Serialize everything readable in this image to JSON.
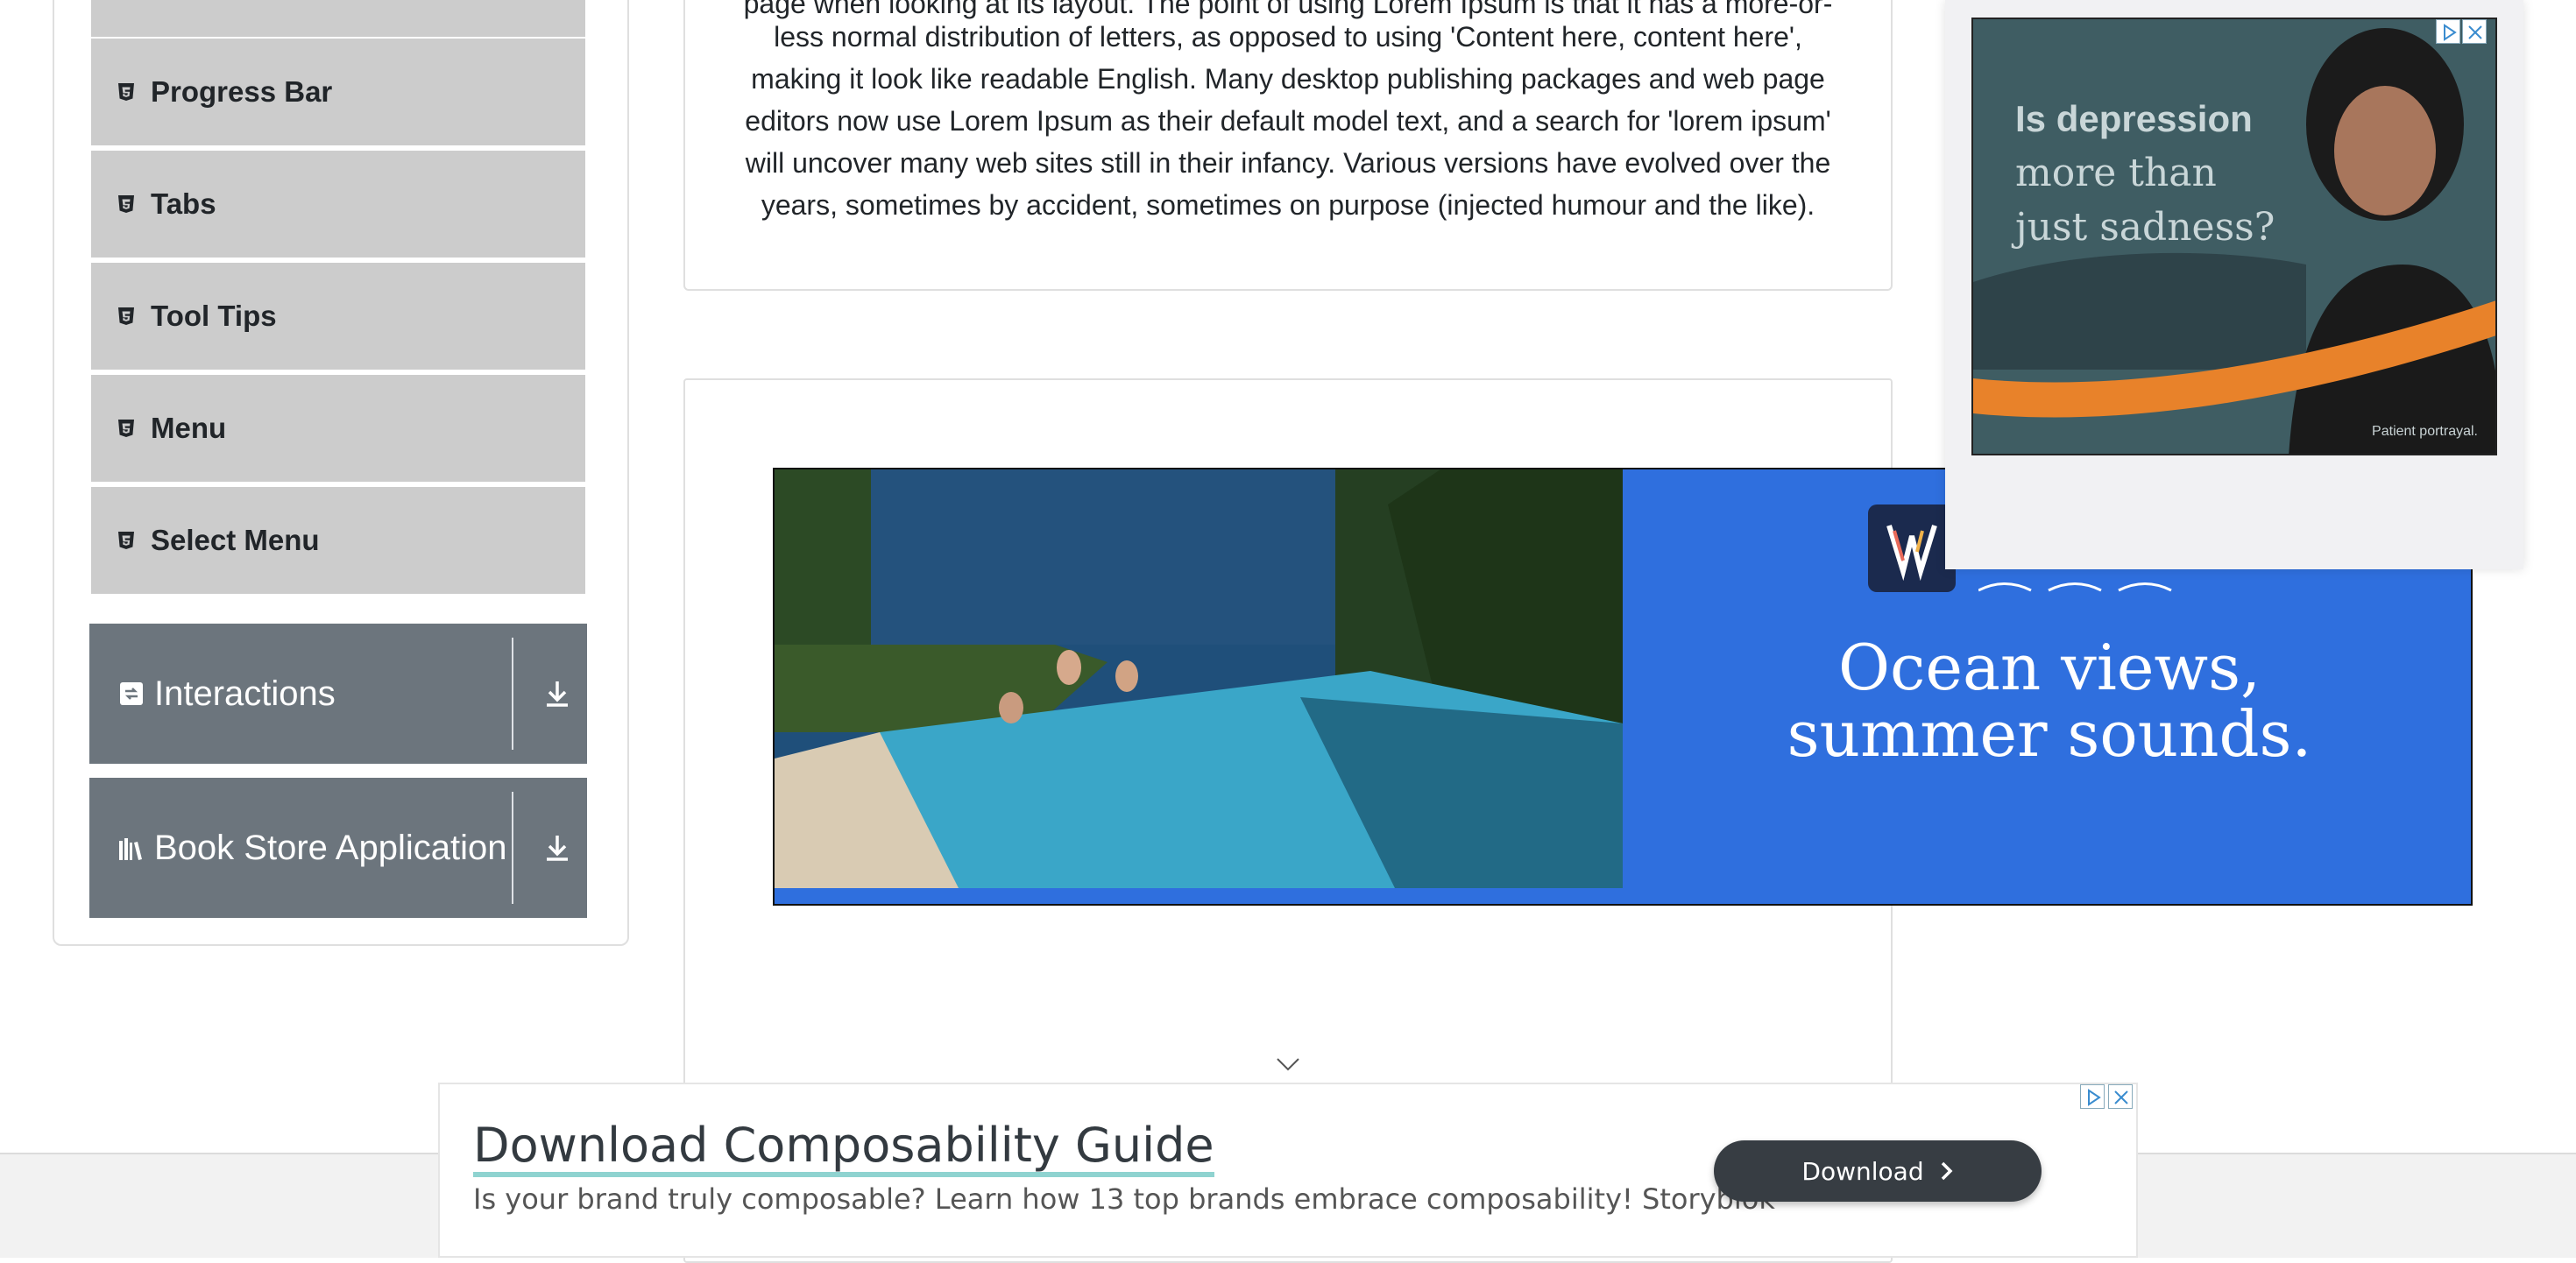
{
  "sidebar": {
    "items": [
      {
        "label": "Progress Bar",
        "icon": "html5-icon"
      },
      {
        "label": "Tabs",
        "icon": "html5-icon"
      },
      {
        "label": "Tool Tips",
        "icon": "html5-icon"
      },
      {
        "label": "Menu",
        "icon": "html5-icon"
      },
      {
        "label": "Select Menu",
        "icon": "html5-icon"
      }
    ],
    "groups": [
      {
        "label": "Interactions",
        "icon": "interactions-icon"
      },
      {
        "label": "Book Store Application",
        "icon": "books-icon"
      }
    ]
  },
  "main": {
    "lorem_lines": [
      "page when looking at its layout. The point of using Lorem Ipsum is that it has a more-or-",
      "less normal distribution of letters, as opposed to using 'Content here, content here',",
      "making it look like readable English. Many desktop publishing packages and web page",
      "editors now use Lorem Ipsum as their default model text, and a search for 'lorem ipsum'",
      "will uncover many web sites still in their infancy. Various versions have evolved over the",
      "years, sometimes by accident, sometimes on purpose (injected humour and the like)."
    ]
  },
  "banner_ad": {
    "headline_line1": "Ocean views,",
    "headline_line2": "summer sounds.",
    "background_color": "#2f6fde"
  },
  "side_ad": {
    "line1": "Is depression",
    "line2": "more than",
    "line3": "just sadness?",
    "caption": "Patient portrayal."
  },
  "bottom_ad": {
    "title": "Download Composability Guide",
    "description": "Is your brand truly composable? Learn how 13 top brands embrace composability! Storyblok",
    "button_label": "Download"
  },
  "colors": {
    "menu_item_bg": "#cccccc",
    "group_header_bg": "#6c757d",
    "button_dark": "#373d43"
  }
}
